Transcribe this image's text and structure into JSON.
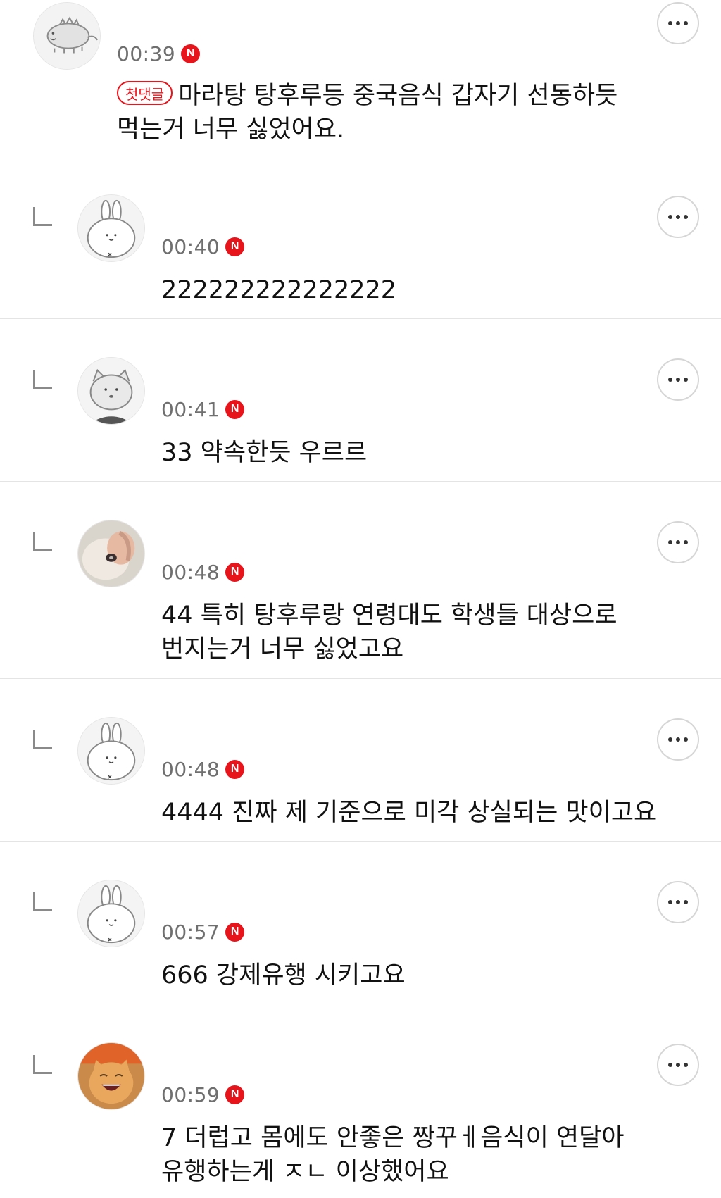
{
  "comments": [
    {
      "time": "00:39",
      "badge": "N",
      "first_label": "첫댓글",
      "text": "마라탕 탕후루등 중국음식 갑자기 선동하듯 먹는거 너무 싫었어요.",
      "avatar_icon": "gray-dinosaur-avatar",
      "is_reply": false
    },
    {
      "time": "00:40",
      "badge": "N",
      "text": "222222222222222",
      "avatar_icon": "white-rabbit-avatar",
      "is_reply": true
    },
    {
      "time": "00:41",
      "badge": "N",
      "text": "33 약속한듯 우르르",
      "avatar_icon": "gray-cat-avatar",
      "is_reply": true
    },
    {
      "time": "00:48",
      "badge": "N",
      "text": "44 특히 탕후루랑 연령대도 학생들 대상으로 번지는거 너무 싫었고요",
      "avatar_icon": "cat-photo-avatar",
      "is_reply": true
    },
    {
      "time": "00:48",
      "badge": "N",
      "text": "4444 진짜 제 기준으로 미각 상실되는 맛이고요",
      "avatar_icon": "white-rabbit-avatar",
      "is_reply": true
    },
    {
      "time": "00:57",
      "badge": "N",
      "text": "666 강제유행 시키고요",
      "avatar_icon": "white-rabbit-avatar",
      "is_reply": true
    },
    {
      "time": "00:59",
      "badge": "N",
      "text": "7 더럽고 몸에도 안좋은 짱꾸ㅔ음식이 연달아 유행하는게 ㅈㄴ 이상했어요",
      "avatar_icon": "laughing-cat-photo-avatar",
      "is_reply": true
    }
  ],
  "colors": {
    "new_badge": "#e8141b",
    "time_text": "#6f6f6f",
    "divider": "#e4e4e4"
  }
}
